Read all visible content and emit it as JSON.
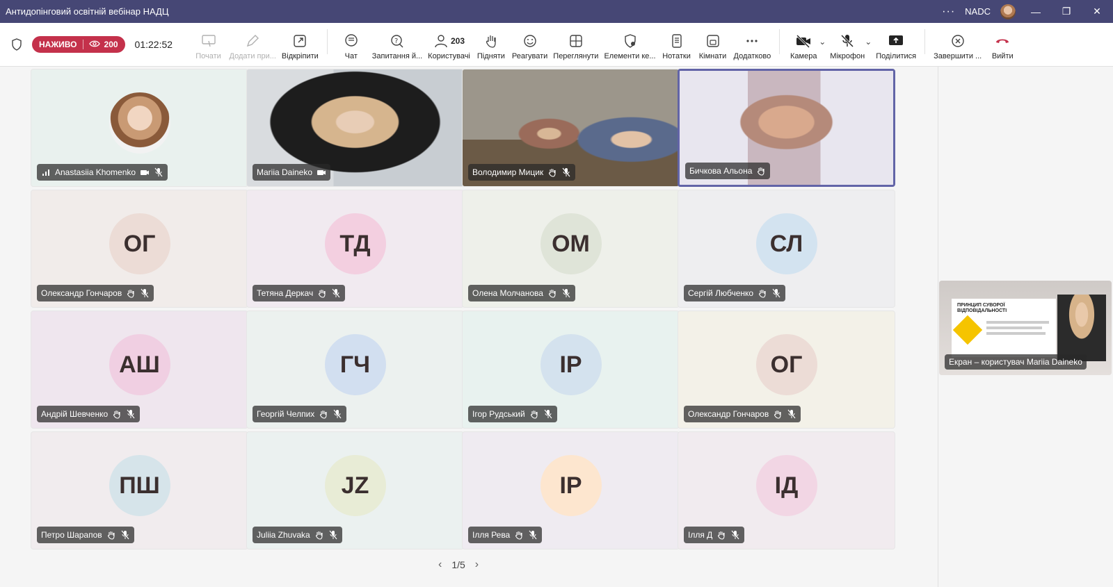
{
  "titlebar": {
    "title": "Антидопінговий освітній вебінар НАДЦ",
    "org": "NADC"
  },
  "toolbar": {
    "live_label": "НАЖИВО",
    "viewers": "200",
    "timer": "01:22:52",
    "tools": [
      {
        "label": "Почати",
        "icon": "screen-start-icon",
        "disabled": true
      },
      {
        "label": "Додати при...",
        "icon": "pen-icon",
        "disabled": true
      },
      {
        "label": "Відкріпити",
        "icon": "popout-icon",
        "disabled": false
      },
      {
        "label": "Чат",
        "icon": "chat-icon",
        "disabled": false
      },
      {
        "label": "Запитання й...",
        "icon": "qa-icon",
        "disabled": false
      },
      {
        "label": "Користувачі",
        "icon": "people-icon",
        "count": "203",
        "disabled": false
      },
      {
        "label": "Підняти",
        "icon": "raise-hand-icon",
        "disabled": false
      },
      {
        "label": "Реагувати",
        "icon": "emoji-icon",
        "disabled": false
      },
      {
        "label": "Переглянути",
        "icon": "grid-icon",
        "disabled": false
      },
      {
        "label": "Елементи ке...",
        "icon": "shield-gear-icon",
        "disabled": false
      },
      {
        "label": "Нотатки",
        "icon": "notes-icon",
        "disabled": false
      },
      {
        "label": "Кімнати",
        "icon": "rooms-icon",
        "disabled": false
      },
      {
        "label": "Додатково",
        "icon": "more-icon",
        "disabled": false
      }
    ],
    "camera_label": "Камера",
    "mic_label": "Мікрофон",
    "share_label": "Поділитися",
    "end_label": "Завершити ...",
    "leave_label": "Вийти"
  },
  "tiles": [
    {
      "name": "Anastasiia Khomenko",
      "type": "photo",
      "bg": "#e9f1ee",
      "icons": [
        "signal-icon",
        "camera-off-icon",
        "mic-off-icon"
      ]
    },
    {
      "name": "Mariia Daineko",
      "type": "video",
      "bg": "#cfd3d6",
      "icons": [
        "camera-off-icon"
      ]
    },
    {
      "name": "Володимир Мицик",
      "type": "video",
      "bg": "#b9b3a6",
      "icons": [
        "hand-icon",
        "mic-off-icon"
      ]
    },
    {
      "name": "Бичкова Альона",
      "type": "video-active",
      "bg": "#e8e6ef",
      "icons": [
        "hand-icon"
      ]
    },
    {
      "name": "Олександр Гончаров",
      "initials": "ОГ",
      "bg": "#f1ecea",
      "avatar": "#ecdcd6",
      "icons": [
        "hand-icon",
        "mic-off-icon"
      ]
    },
    {
      "name": "Тетяна Деркач",
      "initials": "ТД",
      "bg": "#f1eaf0",
      "avatar": "#f3cfe0",
      "icons": [
        "hand-icon",
        "mic-off-icon"
      ]
    },
    {
      "name": "Олена Молчанова",
      "initials": "ОМ",
      "bg": "#eef0ea",
      "avatar": "#dfe4d8",
      "icons": [
        "hand-icon",
        "mic-off-icon"
      ]
    },
    {
      "name": "Сергій Любченко",
      "initials": "СЛ",
      "bg": "#eeeef0",
      "avatar": "#d3e3f0",
      "icons": [
        "hand-icon",
        "mic-off-icon"
      ]
    },
    {
      "name": "Андрій Шевченко",
      "initials": "АШ",
      "bg": "#efe6ee",
      "avatar": "#f0cfe2",
      "icons": [
        "hand-icon",
        "mic-off-icon"
      ]
    },
    {
      "name": "Георгій Челпих",
      "initials": "ГЧ",
      "bg": "#ecf1ef",
      "avatar": "#d2dff0",
      "icons": [
        "hand-icon",
        "mic-off-icon"
      ]
    },
    {
      "name": "Ігор Рудський",
      "initials": "ІР",
      "bg": "#e8f2ef",
      "avatar": "#d4e2ee",
      "icons": [
        "hand-icon",
        "mic-off-icon"
      ]
    },
    {
      "name": "Олександр Гончаров",
      "initials": "ОГ",
      "bg": "#f3f1e8",
      "avatar": "#ecdcd6",
      "icons": [
        "hand-icon",
        "mic-off-icon"
      ]
    },
    {
      "name": "Петро Шарапов",
      "initials": "ПШ",
      "bg": "#f1ecee",
      "avatar": "#d6e4ea",
      "icons": [
        "hand-icon",
        "mic-off-icon"
      ]
    },
    {
      "name": "Juliia Zhuvaka",
      "initials": "JZ",
      "bg": "#ebf1f0",
      "avatar": "#e8ecd6",
      "icons": [
        "hand-icon",
        "mic-off-icon"
      ]
    },
    {
      "name": "Ілля Рева",
      "initials": "ІР",
      "bg": "#efebf1",
      "avatar": "#fde6cf",
      "icons": [
        "hand-icon",
        "mic-off-icon"
      ]
    },
    {
      "name": "Ілля Д",
      "initials": "ІД",
      "bg": "#f1ebef",
      "avatar": "#f2d6e4",
      "icons": [
        "hand-icon",
        "mic-off-icon"
      ]
    }
  ],
  "pager": {
    "label": "1/5"
  },
  "screenshare": {
    "label": "Екран – користувач Mariia Daineko",
    "slide_title": "ПРИНЦИП СУВОРОЇ ВІДПОВІДАЛЬНОСТІ"
  }
}
